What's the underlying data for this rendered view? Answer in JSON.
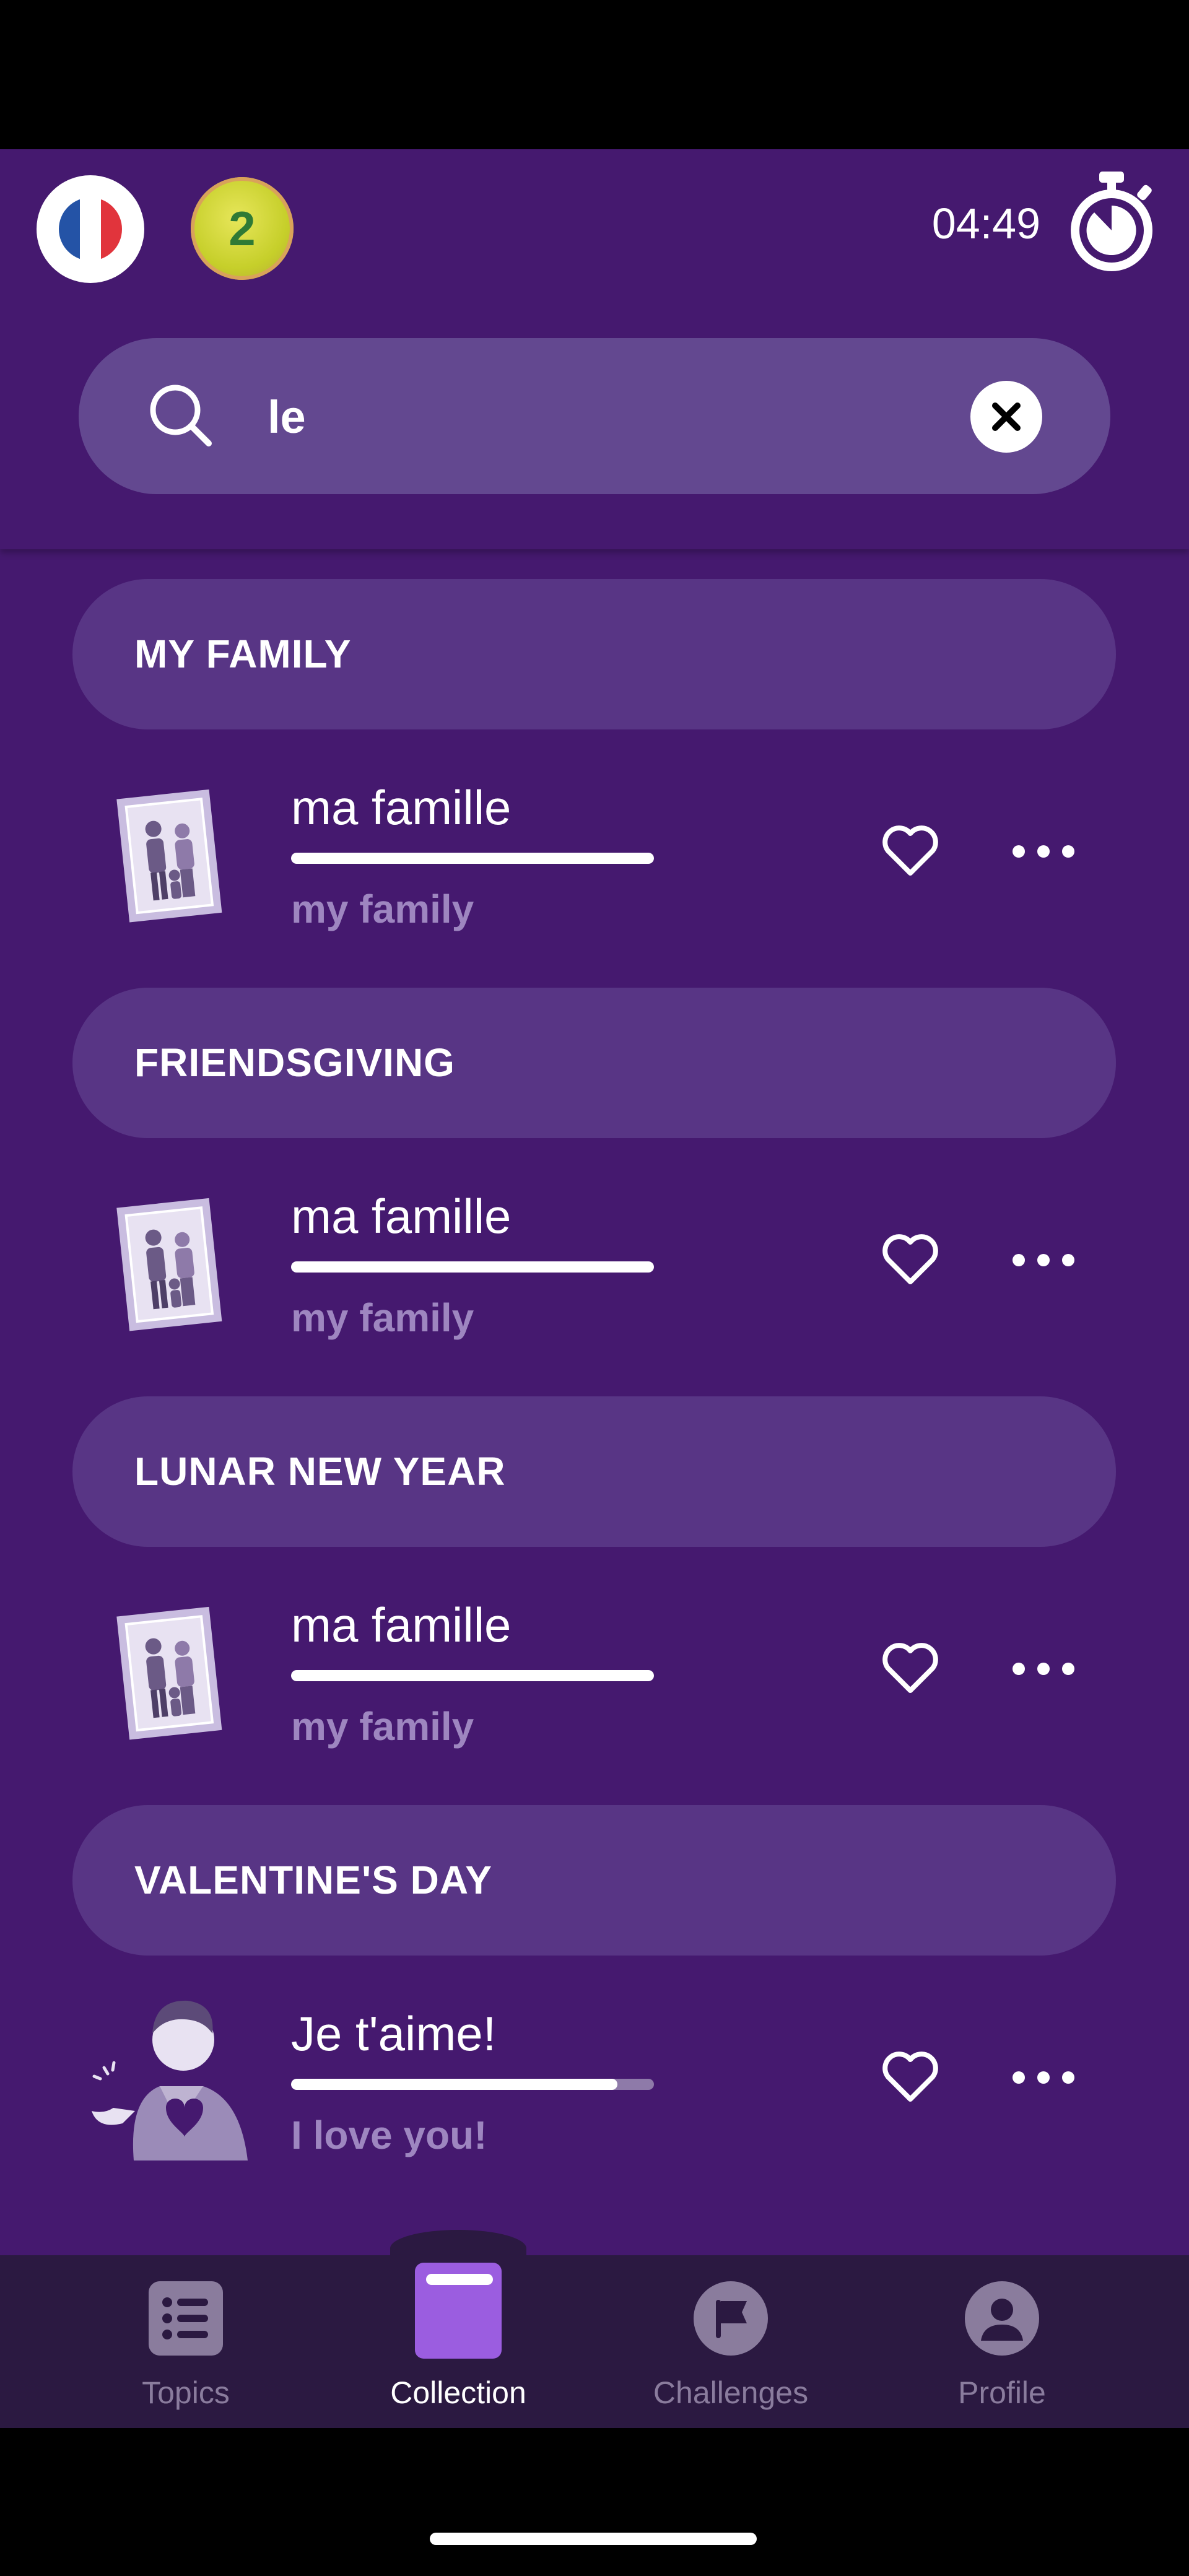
{
  "header": {
    "language_flag": "french-flag-icon",
    "level_badge": "2",
    "timer": "04:49"
  },
  "search": {
    "value": "le"
  },
  "sections": [
    {
      "title": "MY FAMILY",
      "item": {
        "word": "ma famille",
        "translation": "my family",
        "progress": 1.0,
        "image": "family-portrait-icon"
      }
    },
    {
      "title": "FRIENDSGIVING",
      "item": {
        "word": "ma famille",
        "translation": "my family",
        "progress": 1.0,
        "image": "family-portrait-icon"
      }
    },
    {
      "title": "LUNAR NEW YEAR",
      "item": {
        "word": "ma famille",
        "translation": "my family",
        "progress": 1.0,
        "image": "family-portrait-icon"
      }
    },
    {
      "title": "VALENTINE'S DAY",
      "item": {
        "word": "Je t'aime!",
        "translation": "I love you!",
        "progress": 0.9,
        "image": "person-holding-heart-icon"
      }
    }
  ],
  "nav": [
    {
      "label": "Topics",
      "icon": "list-icon"
    },
    {
      "label": "Collection",
      "icon": "book-icon",
      "active": true
    },
    {
      "label": "Challenges",
      "icon": "flag-icon"
    },
    {
      "label": "Profile",
      "icon": "person-icon"
    }
  ],
  "colors": {
    "background": "#45196F",
    "section": "#583585",
    "search": "#634890",
    "nav": "#2b1941",
    "accent": "#9b5de0"
  }
}
